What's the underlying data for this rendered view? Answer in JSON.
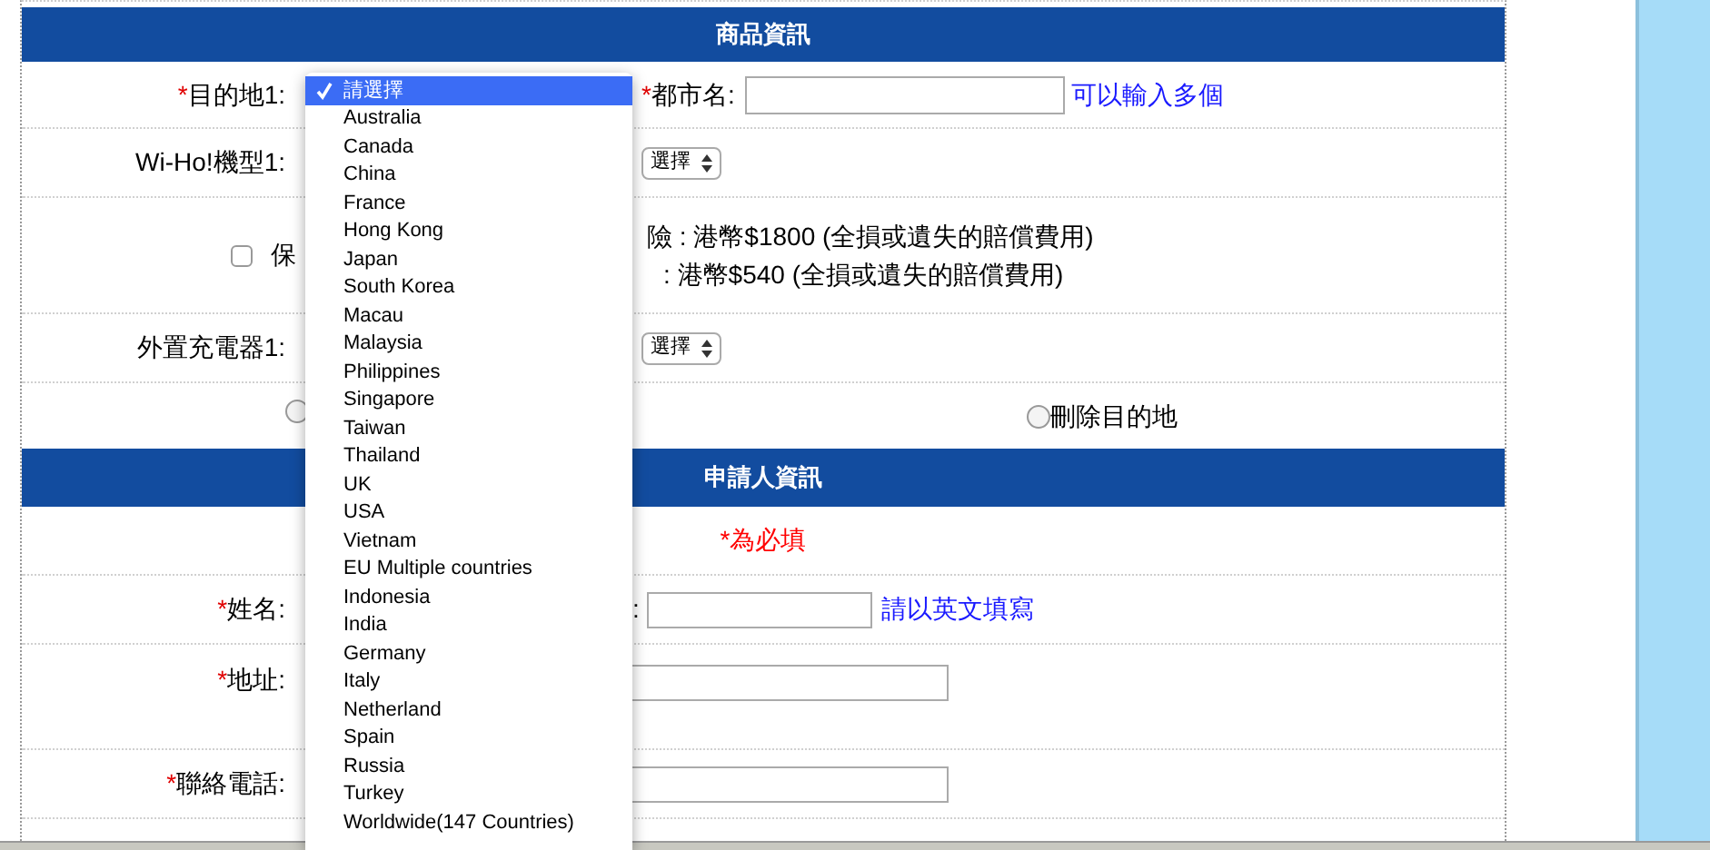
{
  "product_section": {
    "title": "商品資訊",
    "destination": {
      "marker": "*",
      "label": "目的地1:"
    },
    "city": {
      "marker": "*",
      "label": "都市名:",
      "hint": "可以輸入多個"
    },
    "model": {
      "label": "Wi-Ho!機型1:",
      "select_value": "選擇"
    },
    "insurance": {
      "checked": false,
      "label": "保",
      "line_1": "險 : 港幣$1800 (全損或遺失的賠償費用)",
      "line_2": ": 港幣$540 (全損或遺失的賠償費用)"
    },
    "charger": {
      "label": "外置充電器1:",
      "select_value": "選擇"
    },
    "radios": [
      {
        "selected": false
      },
      {
        "selected": false,
        "label": "刪除目的地"
      }
    ]
  },
  "applicant_section": {
    "title": "申請人資訊",
    "required_note": "*為必填",
    "fields": [
      {
        "kind": "name",
        "marker": "*",
        "label": "姓名:",
        "sub_label": ":",
        "hint": "請以英文填寫"
      },
      {
        "kind": "address",
        "marker": "*",
        "label": "地址:"
      },
      {
        "kind": "phone",
        "marker": "*",
        "label": "聯絡電話:"
      }
    ]
  },
  "destination_dropdown": {
    "items": [
      {
        "label": "請選擇",
        "selected": true
      },
      {
        "label": "Australia",
        "selected": false
      },
      {
        "label": "Canada",
        "selected": false
      },
      {
        "label": "China",
        "selected": false
      },
      {
        "label": "France",
        "selected": false
      },
      {
        "label": "Hong Kong",
        "selected": false
      },
      {
        "label": "Japan",
        "selected": false
      },
      {
        "label": "South Korea",
        "selected": false
      },
      {
        "label": "Macau",
        "selected": false
      },
      {
        "label": "Malaysia",
        "selected": false
      },
      {
        "label": "Philippines",
        "selected": false
      },
      {
        "label": "Singapore",
        "selected": false
      },
      {
        "label": "Taiwan",
        "selected": false
      },
      {
        "label": "Thailand",
        "selected": false
      },
      {
        "label": "UK",
        "selected": false
      },
      {
        "label": "USA",
        "selected": false
      },
      {
        "label": "Vietnam",
        "selected": false
      },
      {
        "label": "EU Multiple countries",
        "selected": false
      },
      {
        "label": "Indonesia",
        "selected": false
      },
      {
        "label": "India",
        "selected": false
      },
      {
        "label": "Germany",
        "selected": false
      },
      {
        "label": "Italy",
        "selected": false
      },
      {
        "label": "Netherland",
        "selected": false
      },
      {
        "label": "Spain",
        "selected": false
      },
      {
        "label": "Russia",
        "selected": false
      },
      {
        "label": "Turkey",
        "selected": false
      },
      {
        "label": "Worldwide(147 Countries)",
        "selected": false
      }
    ]
  }
}
